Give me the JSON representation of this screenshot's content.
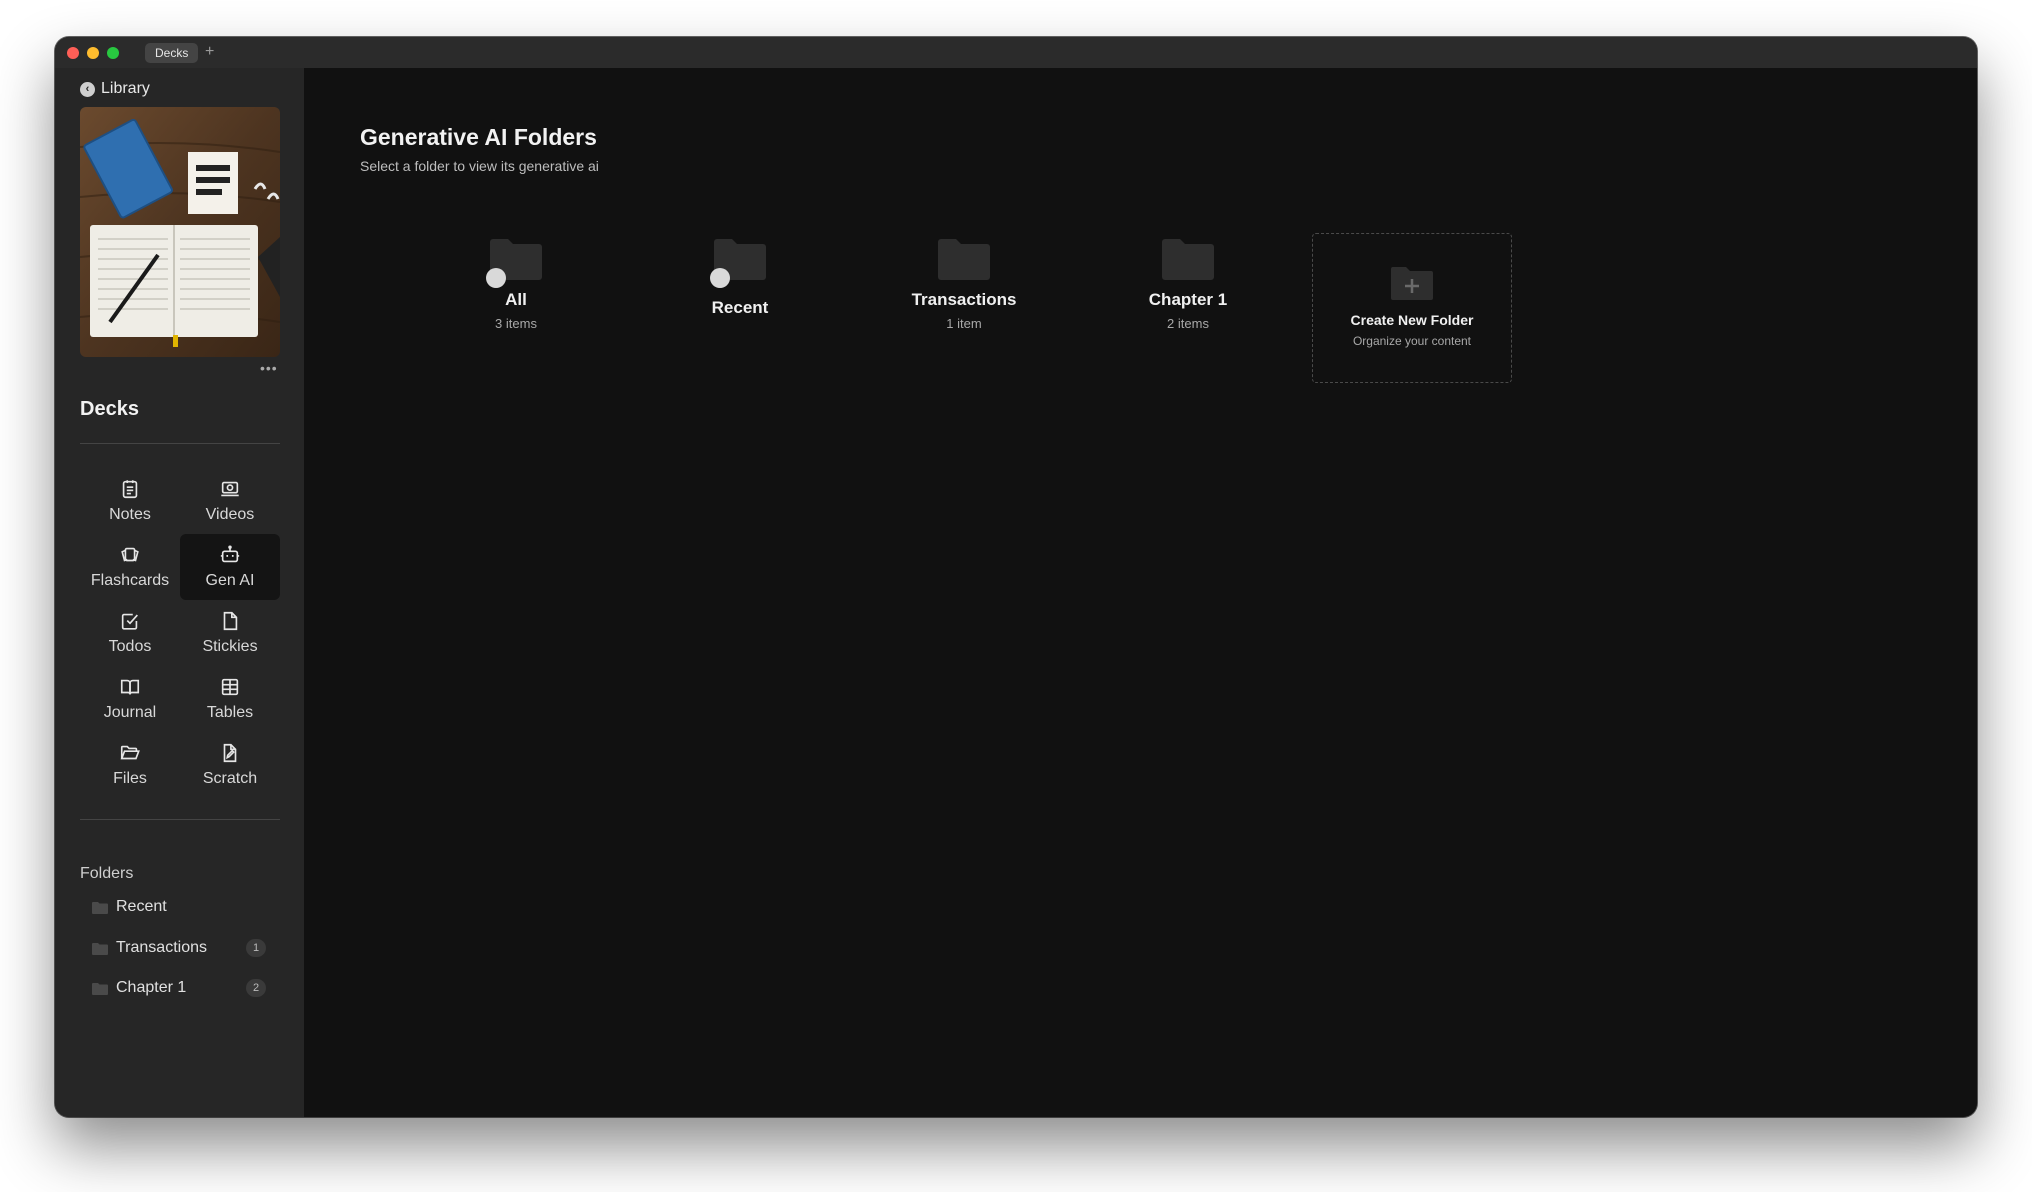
{
  "window": {
    "tab_label": "Decks",
    "new_tab": "+"
  },
  "sidebar": {
    "back_label": "Library",
    "more_label": "•••",
    "title": "Decks",
    "apps": [
      {
        "label": "Notes",
        "icon": "notes-icon"
      },
      {
        "label": "Videos",
        "icon": "video-icon"
      },
      {
        "label": "Flashcards",
        "icon": "flashcards-icon"
      },
      {
        "label": "Gen AI",
        "icon": "robot-icon",
        "active": true
      },
      {
        "label": "Todos",
        "icon": "checkbox-icon"
      },
      {
        "label": "Stickies",
        "icon": "sticky-note-icon"
      },
      {
        "label": "Journal",
        "icon": "book-icon"
      },
      {
        "label": "Tables",
        "icon": "table-icon"
      },
      {
        "label": "Files",
        "icon": "folder-open-icon"
      },
      {
        "label": "Scratch",
        "icon": "file-edit-icon"
      }
    ],
    "folders_label": "Folders",
    "folders": [
      {
        "name": "Recent",
        "count": ""
      },
      {
        "name": "Transactions",
        "count": "1"
      },
      {
        "name": "Chapter 1",
        "count": "2"
      }
    ]
  },
  "main": {
    "title": "Generative AI Folders",
    "subtitle": "Select a folder to view its generative ai",
    "cards": [
      {
        "name": "All",
        "count": "3 items"
      },
      {
        "name": "Recent",
        "count": ""
      },
      {
        "name": "Transactions",
        "count": "1 item"
      },
      {
        "name": "Chapter 1",
        "count": "2 items"
      }
    ],
    "create": {
      "title": "Create New Folder",
      "subtitle": "Organize your content"
    }
  },
  "colors": {
    "window_bg": "#111111",
    "sidebar_bg": "#262626",
    "folder_gray": "#2e2e2e"
  }
}
